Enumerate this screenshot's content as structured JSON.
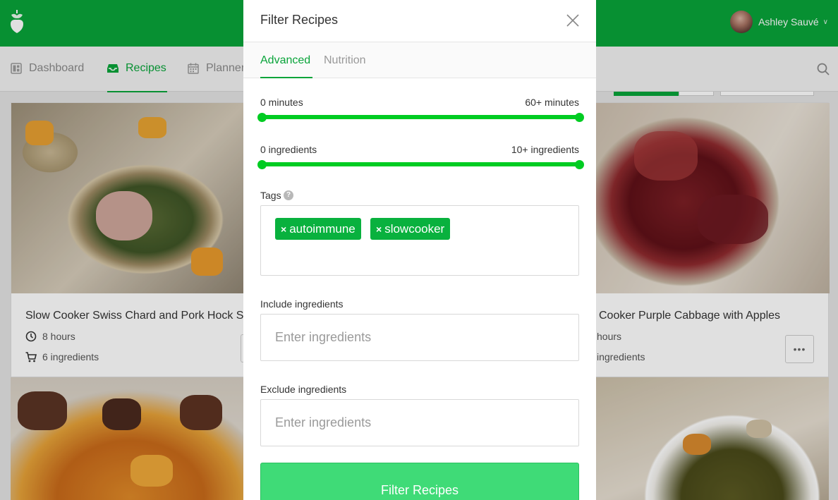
{
  "colors": {
    "brand_green": "#09a43a",
    "slider_green": "#00cc22",
    "tag_green": "#09b13e",
    "button_green": "#3fdb77"
  },
  "header": {
    "user_name": "Ashley Sauvé"
  },
  "nav": {
    "items": [
      {
        "label": "Dashboard",
        "icon": "dashboard-icon"
      },
      {
        "label": "Recipes",
        "icon": "inbox-icon"
      },
      {
        "label": "Planner",
        "icon": "calendar-icon"
      }
    ],
    "active": "Recipes"
  },
  "cards": [
    {
      "title": "Slow Cooker Swiss Chard and Pork Hock S",
      "time": "8 hours",
      "ingredients": "6 ingredients"
    },
    {
      "title": "Cooker Purple Cabbage with Apples",
      "time": "hours",
      "ingredients": "ingredients"
    }
  ],
  "modal": {
    "title": "Filter Recipes",
    "tabs": [
      "Advanced",
      "Nutrition"
    ],
    "active_tab": "Advanced",
    "time_slider": {
      "min_label": "0 minutes",
      "max_label": "60+ minutes",
      "low": 0,
      "high": 60
    },
    "ingredient_slider": {
      "min_label": "0 ingredients",
      "max_label": "10+ ingredients",
      "low": 0,
      "high": 10
    },
    "tags_label": "Tags",
    "tags": [
      "autoimmune",
      "slowcooker"
    ],
    "include_label": "Include ingredients",
    "include_placeholder": "Enter ingredients",
    "exclude_label": "Exclude ingredients",
    "exclude_placeholder": "Enter ingredients",
    "submit_label": "Filter Recipes"
  }
}
